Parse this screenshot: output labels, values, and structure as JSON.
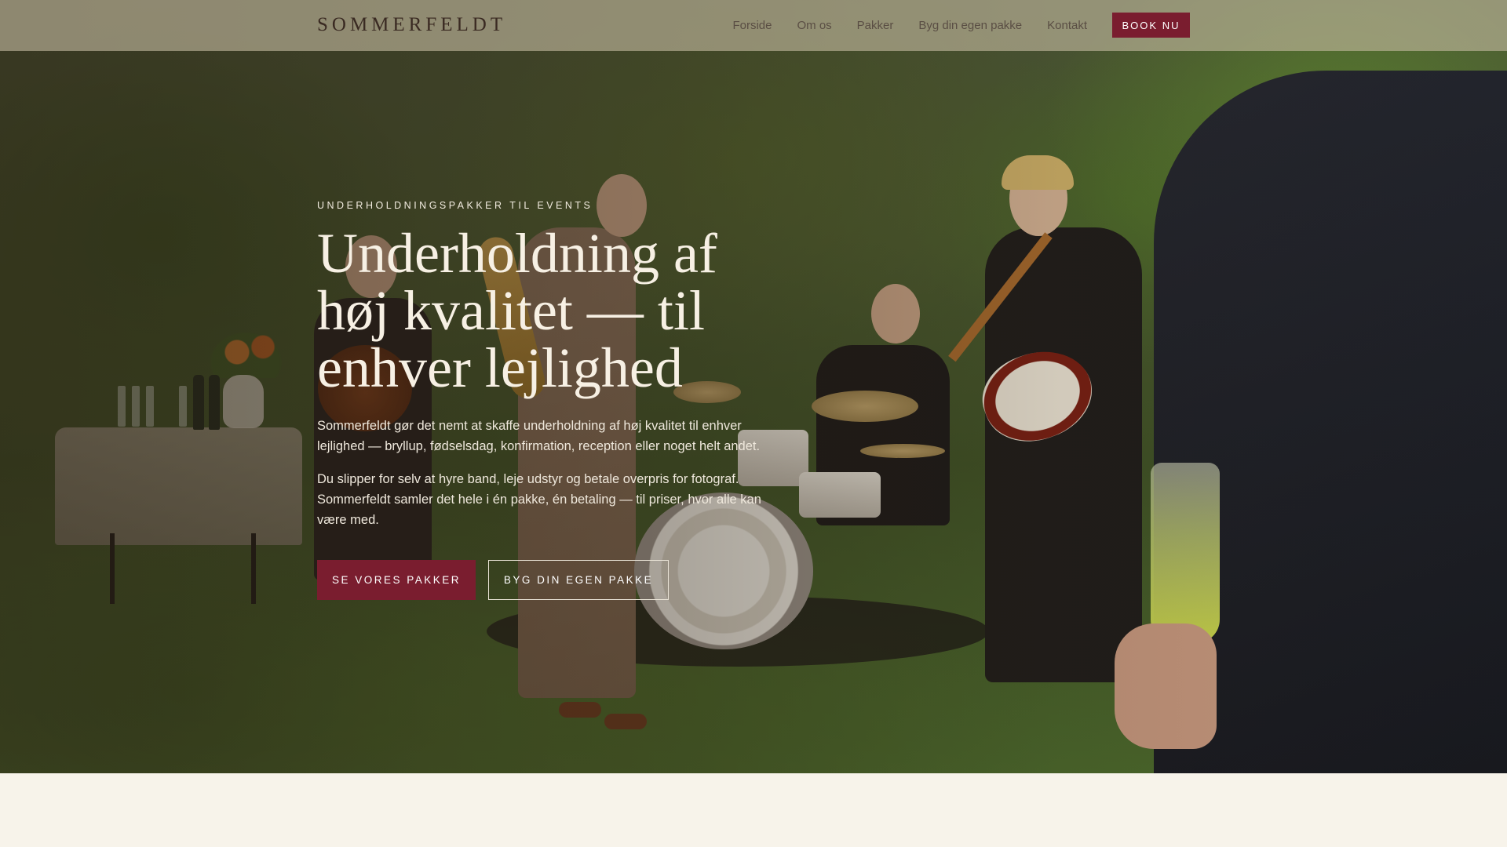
{
  "nav": {
    "logo": "SOMMERFELDT",
    "links": [
      "Forside",
      "Om os",
      "Pakker",
      "Byg din egen pakke",
      "Kontakt"
    ],
    "book_label": "BOOK NU"
  },
  "hero": {
    "eyebrow": "UNDERHOLDNINGSPAKKER TIL EVENTS",
    "headline": "Underholdning af høj kvalitet — til enhver lejlighed",
    "paragraph_1": "Sommerfeldt gør det nemt at skaffe underholdning af høj kvalitet til enhver lejlighed — bryllup, fødselsdag, konfirmation, reception eller noget helt andet.",
    "paragraph_2": "Du slipper for selv at hyre band, leje udstyr og betale overpris for fotograf. Sommerfeldt samler det hele i én pakke, én betaling — til priser, hvor alle kan være med.",
    "cta_primary": "SE VORES PAKKER",
    "cta_secondary": "BYG DIN EGEN PAKKE"
  },
  "colors": {
    "accent": "#7a1d2f",
    "cream": "#f7f3ea",
    "nav_text": "#5a4e44"
  }
}
